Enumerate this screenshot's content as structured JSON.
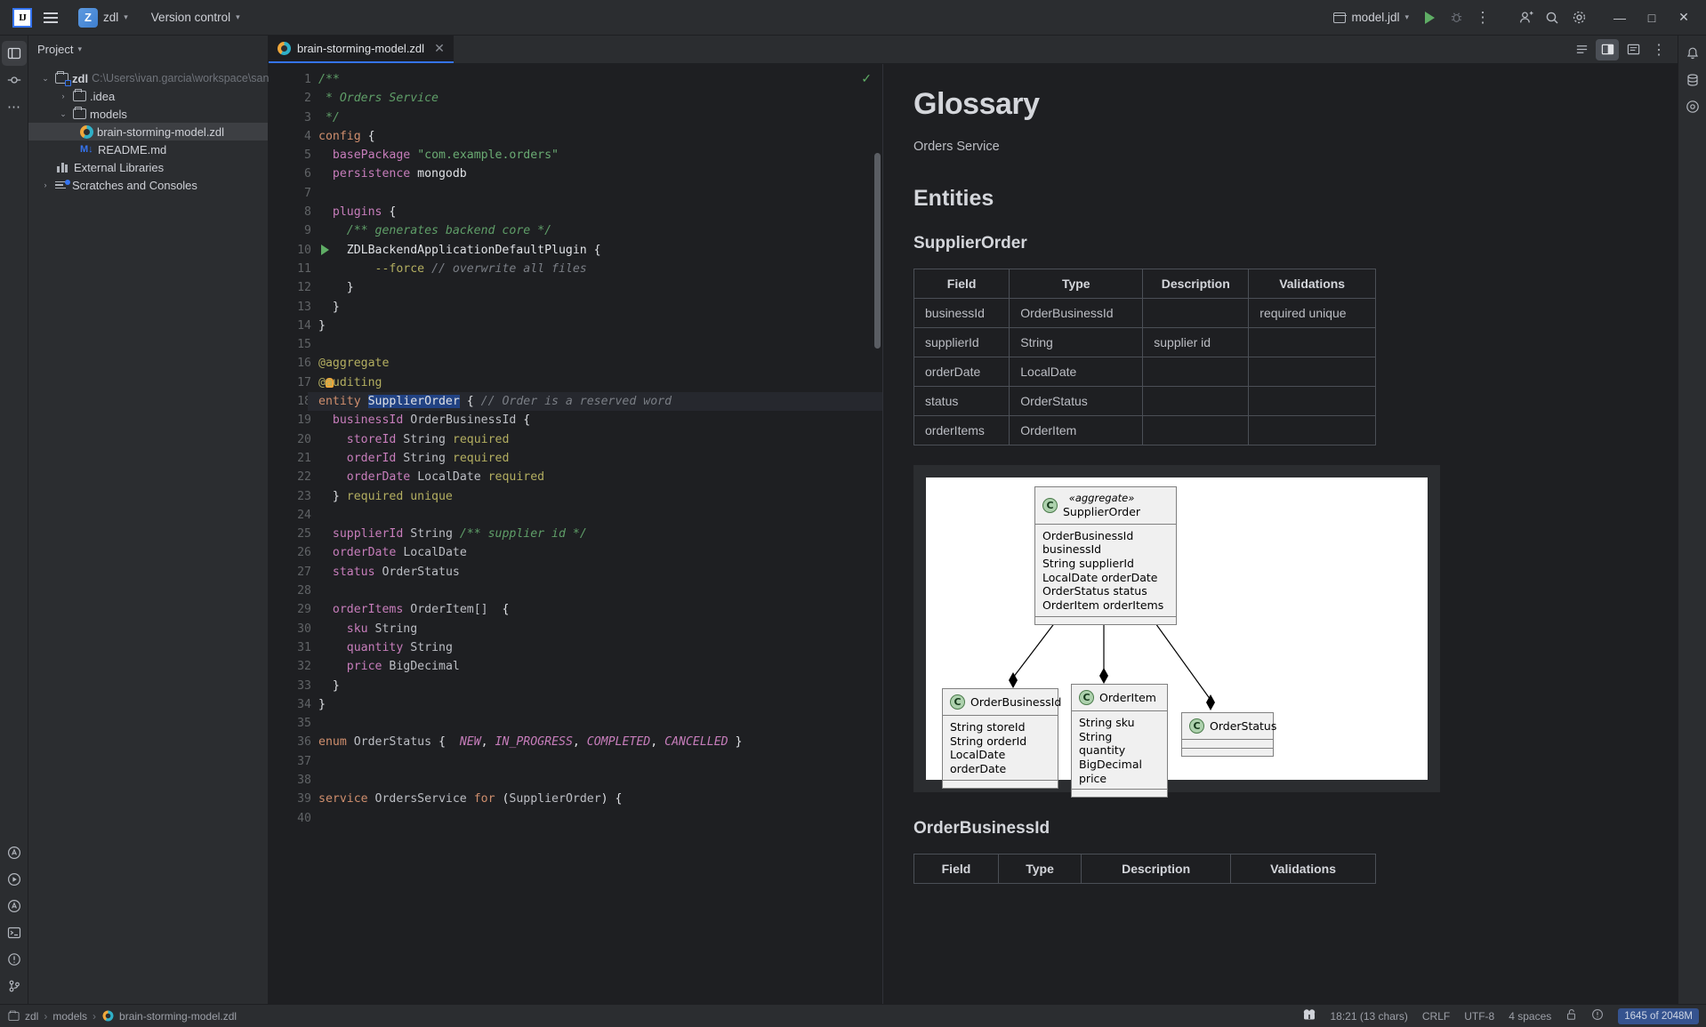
{
  "toolbar": {
    "logo": "IJ",
    "menu_icon": "hamburger-icon",
    "project_badge": "Z",
    "project_name": "zdl",
    "version_control": "Version control",
    "run_config": "model.jdl",
    "more_icon": "⋮",
    "account_icon": "account-icon",
    "search_icon": "search-icon",
    "settings_icon": "gear-icon",
    "minimize": "—",
    "maximize": "□",
    "close": "✕"
  },
  "project_panel": {
    "title": "Project",
    "tree": [
      {
        "label": "zdl",
        "path": "C:\\Users\\ivan.garcia\\workspace\\sandbox\\zdl",
        "icon": "module-folder-icon",
        "arrow": "⌄",
        "depth": 0,
        "selected": false
      },
      {
        "label": ".idea",
        "path": "",
        "icon": "folder-icon",
        "arrow": "›",
        "depth": 1,
        "selected": false
      },
      {
        "label": "models",
        "path": "",
        "icon": "folder-icon",
        "arrow": "⌄",
        "depth": 1,
        "selected": false
      },
      {
        "label": "brain-storming-model.zdl",
        "path": "",
        "icon": "zdl-file-icon",
        "arrow": "",
        "depth": 2,
        "selected": true
      },
      {
        "label": "README.md",
        "path": "",
        "icon": "markdown-icon",
        "arrow": "",
        "depth": 1,
        "selected": false
      },
      {
        "label": "External Libraries",
        "path": "",
        "icon": "library-icon",
        "arrow": "",
        "depth": 0,
        "selected": false
      },
      {
        "label": "Scratches and Consoles",
        "path": "",
        "icon": "scratches-icon",
        "arrow": "›",
        "depth": 0,
        "selected": false
      }
    ]
  },
  "editor": {
    "tab_label": "brain-storming-model.zdl",
    "tab_close": "✕",
    "inspection_ok": "✓",
    "code": [
      {
        "n": 1,
        "html": "<span class='doc'>/**</span>"
      },
      {
        "n": 2,
        "html": "<span class='doc'> * Orders Service</span>"
      },
      {
        "n": 3,
        "html": "<span class='doc'> */</span>"
      },
      {
        "n": 4,
        "html": "<span class='k'>config</span> {"
      },
      {
        "n": 5,
        "html": "  <span class='p'>basePackage</span> <span class='s'>\"com.example.orders\"</span>"
      },
      {
        "n": 6,
        "html": "  <span class='p'>persistence</span> mongodb"
      },
      {
        "n": 7,
        "html": ""
      },
      {
        "n": 8,
        "html": "  <span class='p'>plugins</span> {"
      },
      {
        "n": 9,
        "html": "    <span class='doc'>/** generates backend core */</span>"
      },
      {
        "n": 10,
        "html": "    ZDLBackendApplicationDefaultPlugin {",
        "run": true
      },
      {
        "n": 11,
        "html": "        <span class='an'>--force</span> <span class='cm'>// overwrite all files</span>"
      },
      {
        "n": 12,
        "html": "    }"
      },
      {
        "n": 13,
        "html": "  }"
      },
      {
        "n": 14,
        "html": "}"
      },
      {
        "n": 15,
        "html": ""
      },
      {
        "n": 16,
        "html": "<span class='an'>@aggregate</span>"
      },
      {
        "n": 17,
        "html": "<span class='an'>@auditing</span>",
        "bulb": true
      },
      {
        "n": 18,
        "html": "<span class='k'>entity</span> <span class='sel-tok'>SupplierOrder</span> { <span class='cm'>// Order is a reserved word</span>",
        "current": true
      },
      {
        "n": 19,
        "html": "  <span class='p'>businessId</span> <span class='t'>OrderBusinessId</span> {"
      },
      {
        "n": 20,
        "html": "    <span class='p'>storeId</span> <span class='t'>String</span> <span class='an'>required</span>"
      },
      {
        "n": 21,
        "html": "    <span class='p'>orderId</span> <span class='t'>String</span> <span class='an'>required</span>"
      },
      {
        "n": 22,
        "html": "    <span class='p'>orderDate</span> <span class='t'>LocalDate</span> <span class='an'>required</span>"
      },
      {
        "n": 23,
        "html": "  } <span class='an'>required unique</span>"
      },
      {
        "n": 24,
        "html": ""
      },
      {
        "n": 25,
        "html": "  <span class='p'>supplierId</span> <span class='t'>String</span> <span class='doc'>/** supplier id */</span>"
      },
      {
        "n": 26,
        "html": "  <span class='p'>orderDate</span> <span class='t'>LocalDate</span>"
      },
      {
        "n": 27,
        "html": "  <span class='p'>status</span> <span class='t'>OrderStatus</span>"
      },
      {
        "n": 28,
        "html": ""
      },
      {
        "n": 29,
        "html": "  <span class='p'>orderItems</span> <span class='t'>OrderItem[]</span>  {"
      },
      {
        "n": 30,
        "html": "    <span class='p'>sku</span> <span class='t'>String</span>"
      },
      {
        "n": 31,
        "html": "    <span class='p'>quantity</span> <span class='t'>String</span>"
      },
      {
        "n": 32,
        "html": "    <span class='p'>price</span> <span class='t'>BigDecimal</span>"
      },
      {
        "n": 33,
        "html": "  }"
      },
      {
        "n": 34,
        "html": "}"
      },
      {
        "n": 35,
        "html": ""
      },
      {
        "n": 36,
        "html": "<span class='k'>enum</span> <span class='t'>OrderStatus</span> {  <span class='en'>NEW</span>, <span class='en'>IN_PROGRESS</span>, <span class='en'>COMPLETED</span>, <span class='en'>CANCELLED</span> }"
      },
      {
        "n": 37,
        "html": ""
      },
      {
        "n": 38,
        "html": ""
      },
      {
        "n": 39,
        "html": "<span class='k'>service</span> <span class='t'>OrdersService</span> <span class='k'>for</span> (<span class='t'>SupplierOrder</span>) {"
      },
      {
        "n": 40,
        "html": ""
      }
    ]
  },
  "preview": {
    "title": "Glossary",
    "subtitle": "Orders Service",
    "entities_heading": "Entities",
    "entity1": {
      "name": "SupplierOrder",
      "columns": [
        "Field",
        "Type",
        "Description",
        "Validations"
      ],
      "rows": [
        [
          "businessId",
          "OrderBusinessId",
          "",
          "required unique"
        ],
        [
          "supplierId",
          "String",
          "supplier id",
          ""
        ],
        [
          "orderDate",
          "LocalDate",
          "",
          ""
        ],
        [
          "status",
          "OrderStatus",
          "",
          ""
        ],
        [
          "orderItems",
          "OrderItem",
          "",
          ""
        ]
      ]
    },
    "entity2": {
      "name": "OrderBusinessId",
      "columns": [
        "Field",
        "Type",
        "Description",
        "Validations"
      ]
    },
    "diagram": {
      "classes": [
        {
          "id": "supplierorder",
          "stereotype": "«aggregate»",
          "name": "SupplierOrder",
          "attrs": [
            "OrderBusinessId businessId",
            "String supplierId",
            "LocalDate orderDate",
            "OrderStatus status",
            "OrderItem orderItems"
          ]
        },
        {
          "id": "orderbusinessid",
          "stereotype": "",
          "name": "OrderBusinessId",
          "attrs": [
            "String storeId",
            "String orderId",
            "LocalDate orderDate"
          ]
        },
        {
          "id": "orderitem",
          "stereotype": "",
          "name": "OrderItem",
          "attrs": [
            "String sku",
            "String quantity",
            "BigDecimal price"
          ]
        },
        {
          "id": "orderstatus",
          "stereotype": "",
          "name": "OrderStatus",
          "attrs": []
        }
      ],
      "class_badge": "C"
    }
  },
  "status_bar": {
    "breadcrumbs": [
      "zdl",
      "models",
      "brain-storming-model.zdl"
    ],
    "caret": "18:21 (13 chars)",
    "line_sep": "CRLF",
    "encoding": "UTF-8",
    "indent": "4 spaces",
    "lock_icon": "unlocked-icon",
    "inspection_icon": "inspection-icon",
    "memory": "1645 of 2048M"
  },
  "colors": {
    "accent": "#3574f0",
    "run_green": "#5fad65",
    "selection": "#214283",
    "toolbar_bg": "#2b2d30",
    "editor_bg": "#1e1f22"
  }
}
